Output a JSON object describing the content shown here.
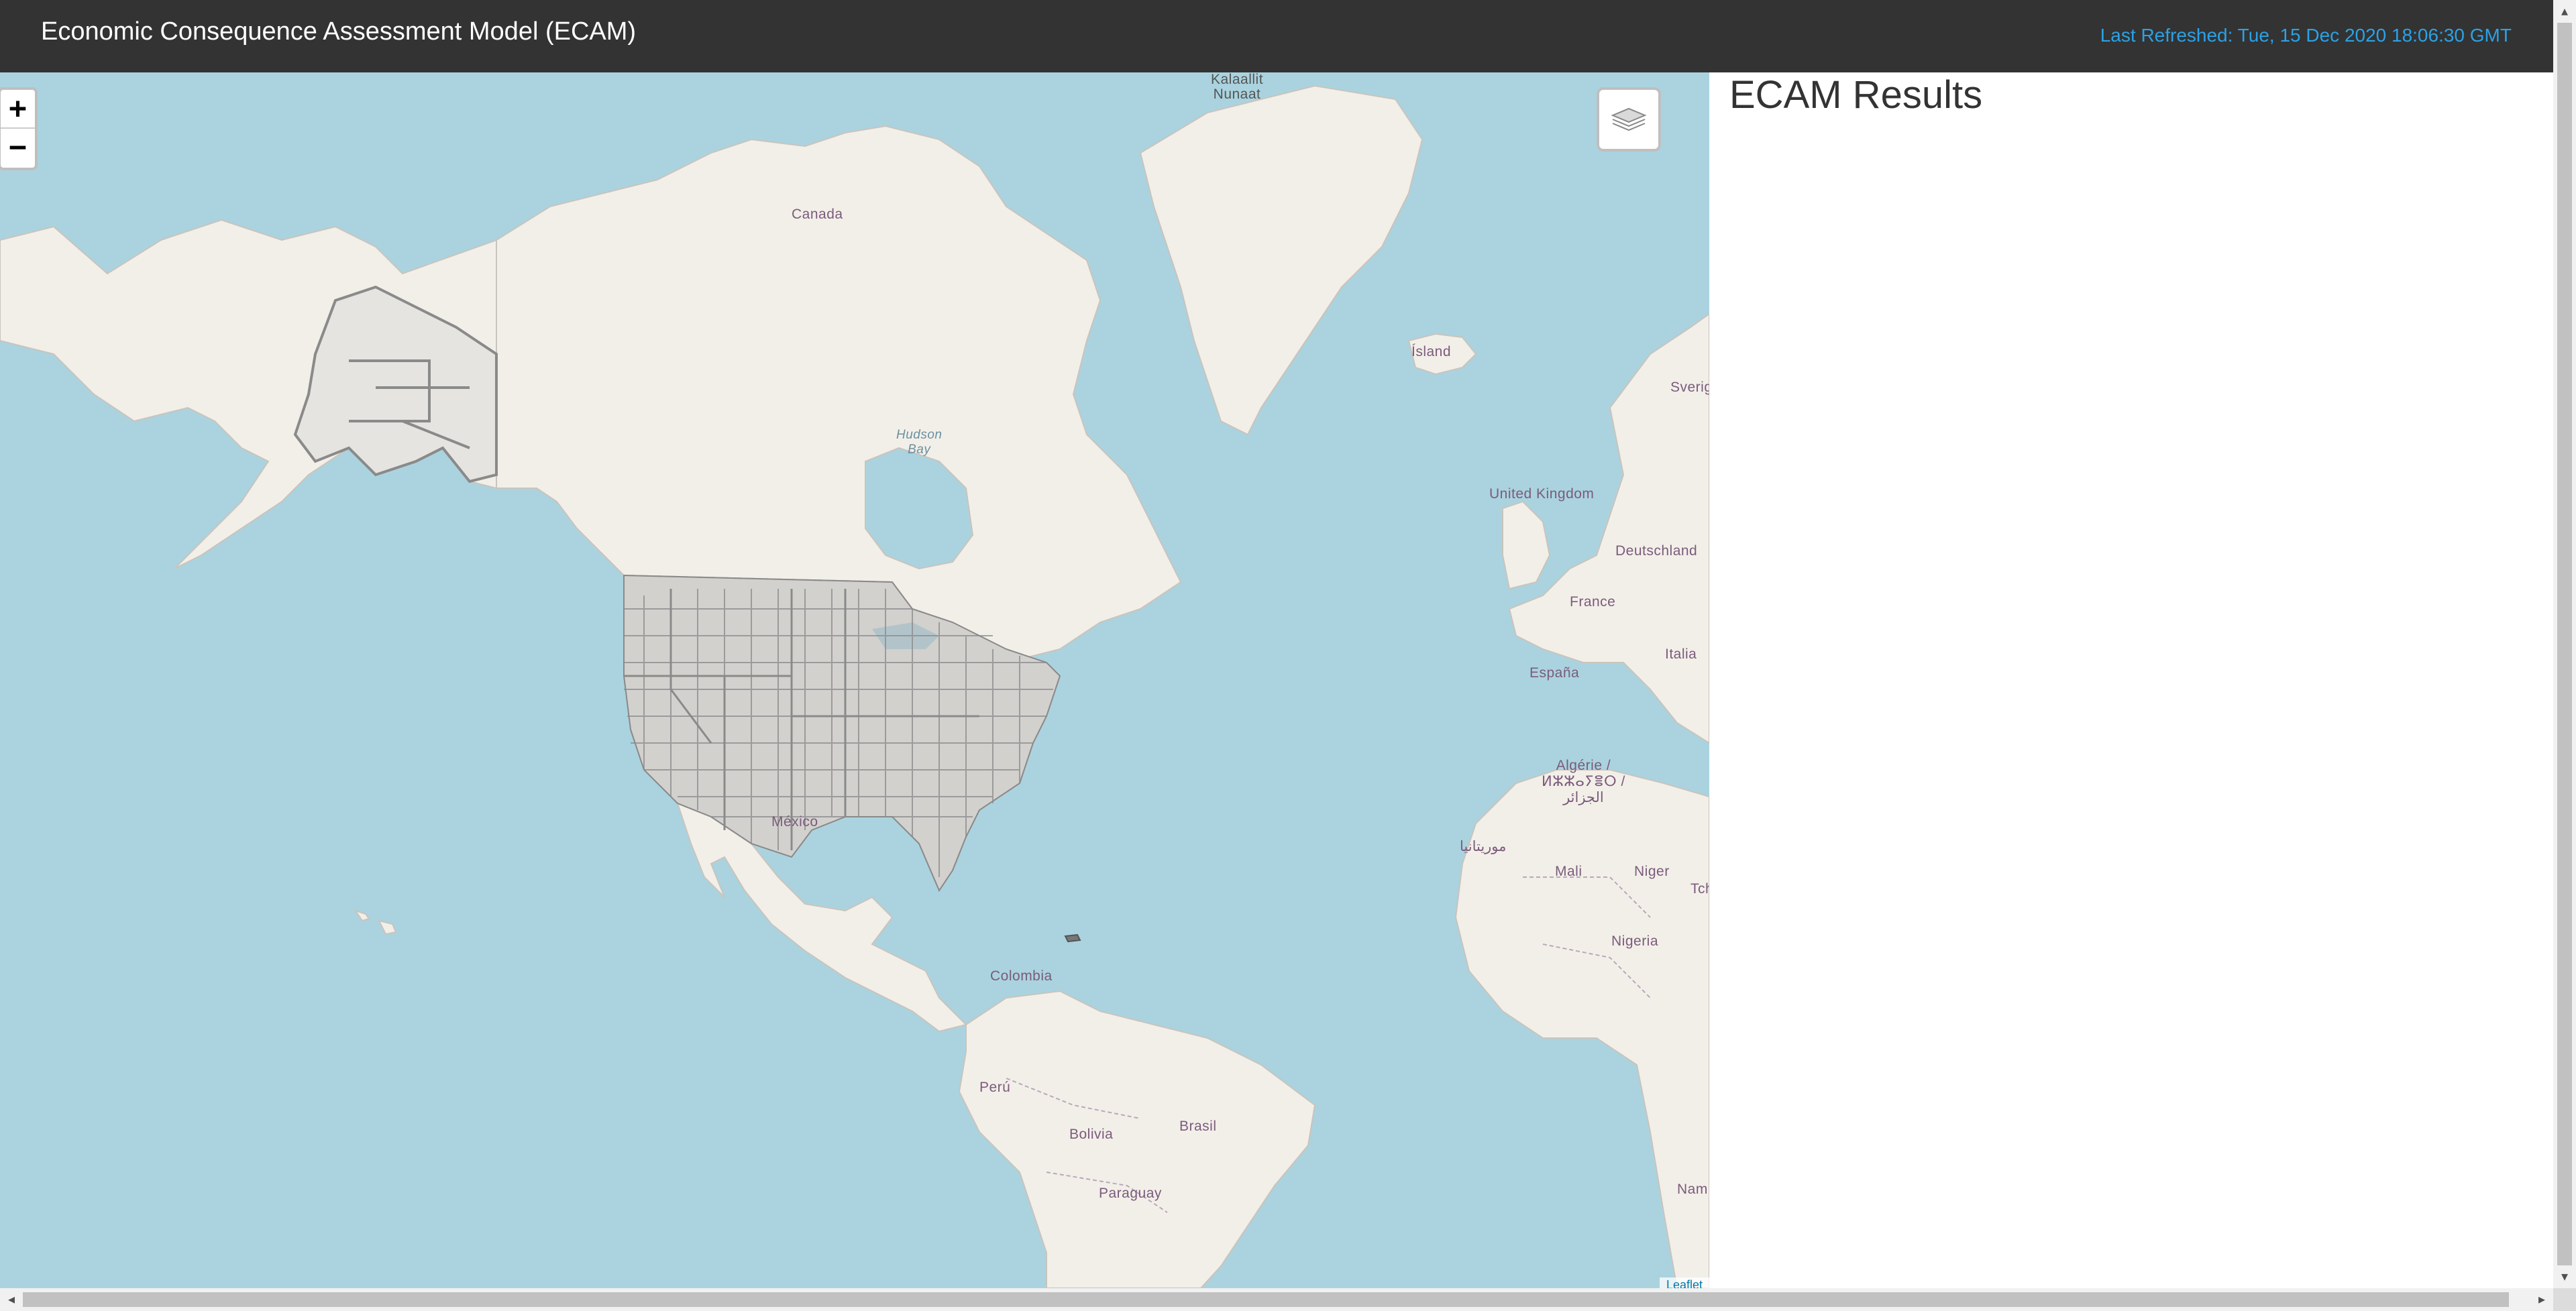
{
  "header": {
    "title": "Economic Consequence Assessment Model (ECAM)",
    "last_refreshed": "Last Refreshed: Tue, 15 Dec 2020 18:06:30 GMT"
  },
  "map": {
    "zoom_in_label": "+",
    "zoom_out_label": "−",
    "layers_icon": "layers-icon",
    "attribution": "Leaflet",
    "labels": {
      "kalaallit": "Kalaallit\nNunaat",
      "canada": "Canada",
      "hudson_bay": "Hudson\nBay",
      "island": "Ísland",
      "sverige": "Sverig",
      "united_kingdom": "United Kingdom",
      "deutschland": "Deutschland",
      "france": "France",
      "italia": "Italia",
      "espana": "España",
      "algerie": "Algérie /\nⵍⵣⵣⴰⵢⴻⵔ /\nالجزائر",
      "mauritania": "موريتانيا",
      "mali": "Mali",
      "niger": "Niger",
      "tchad": "Tcha",
      "nigeria": "Nigeria",
      "mexico": "México",
      "colombia": "Colombia",
      "peru": "Perú",
      "bolivia": "Bolivia",
      "brasil": "Brasil",
      "paraguay": "Paraguay",
      "namibia": "Nam"
    },
    "colors": {
      "water": "#aad3df",
      "land": "#f2efe9",
      "county_outline": "#888888"
    }
  },
  "results": {
    "title": "ECAM Results"
  }
}
